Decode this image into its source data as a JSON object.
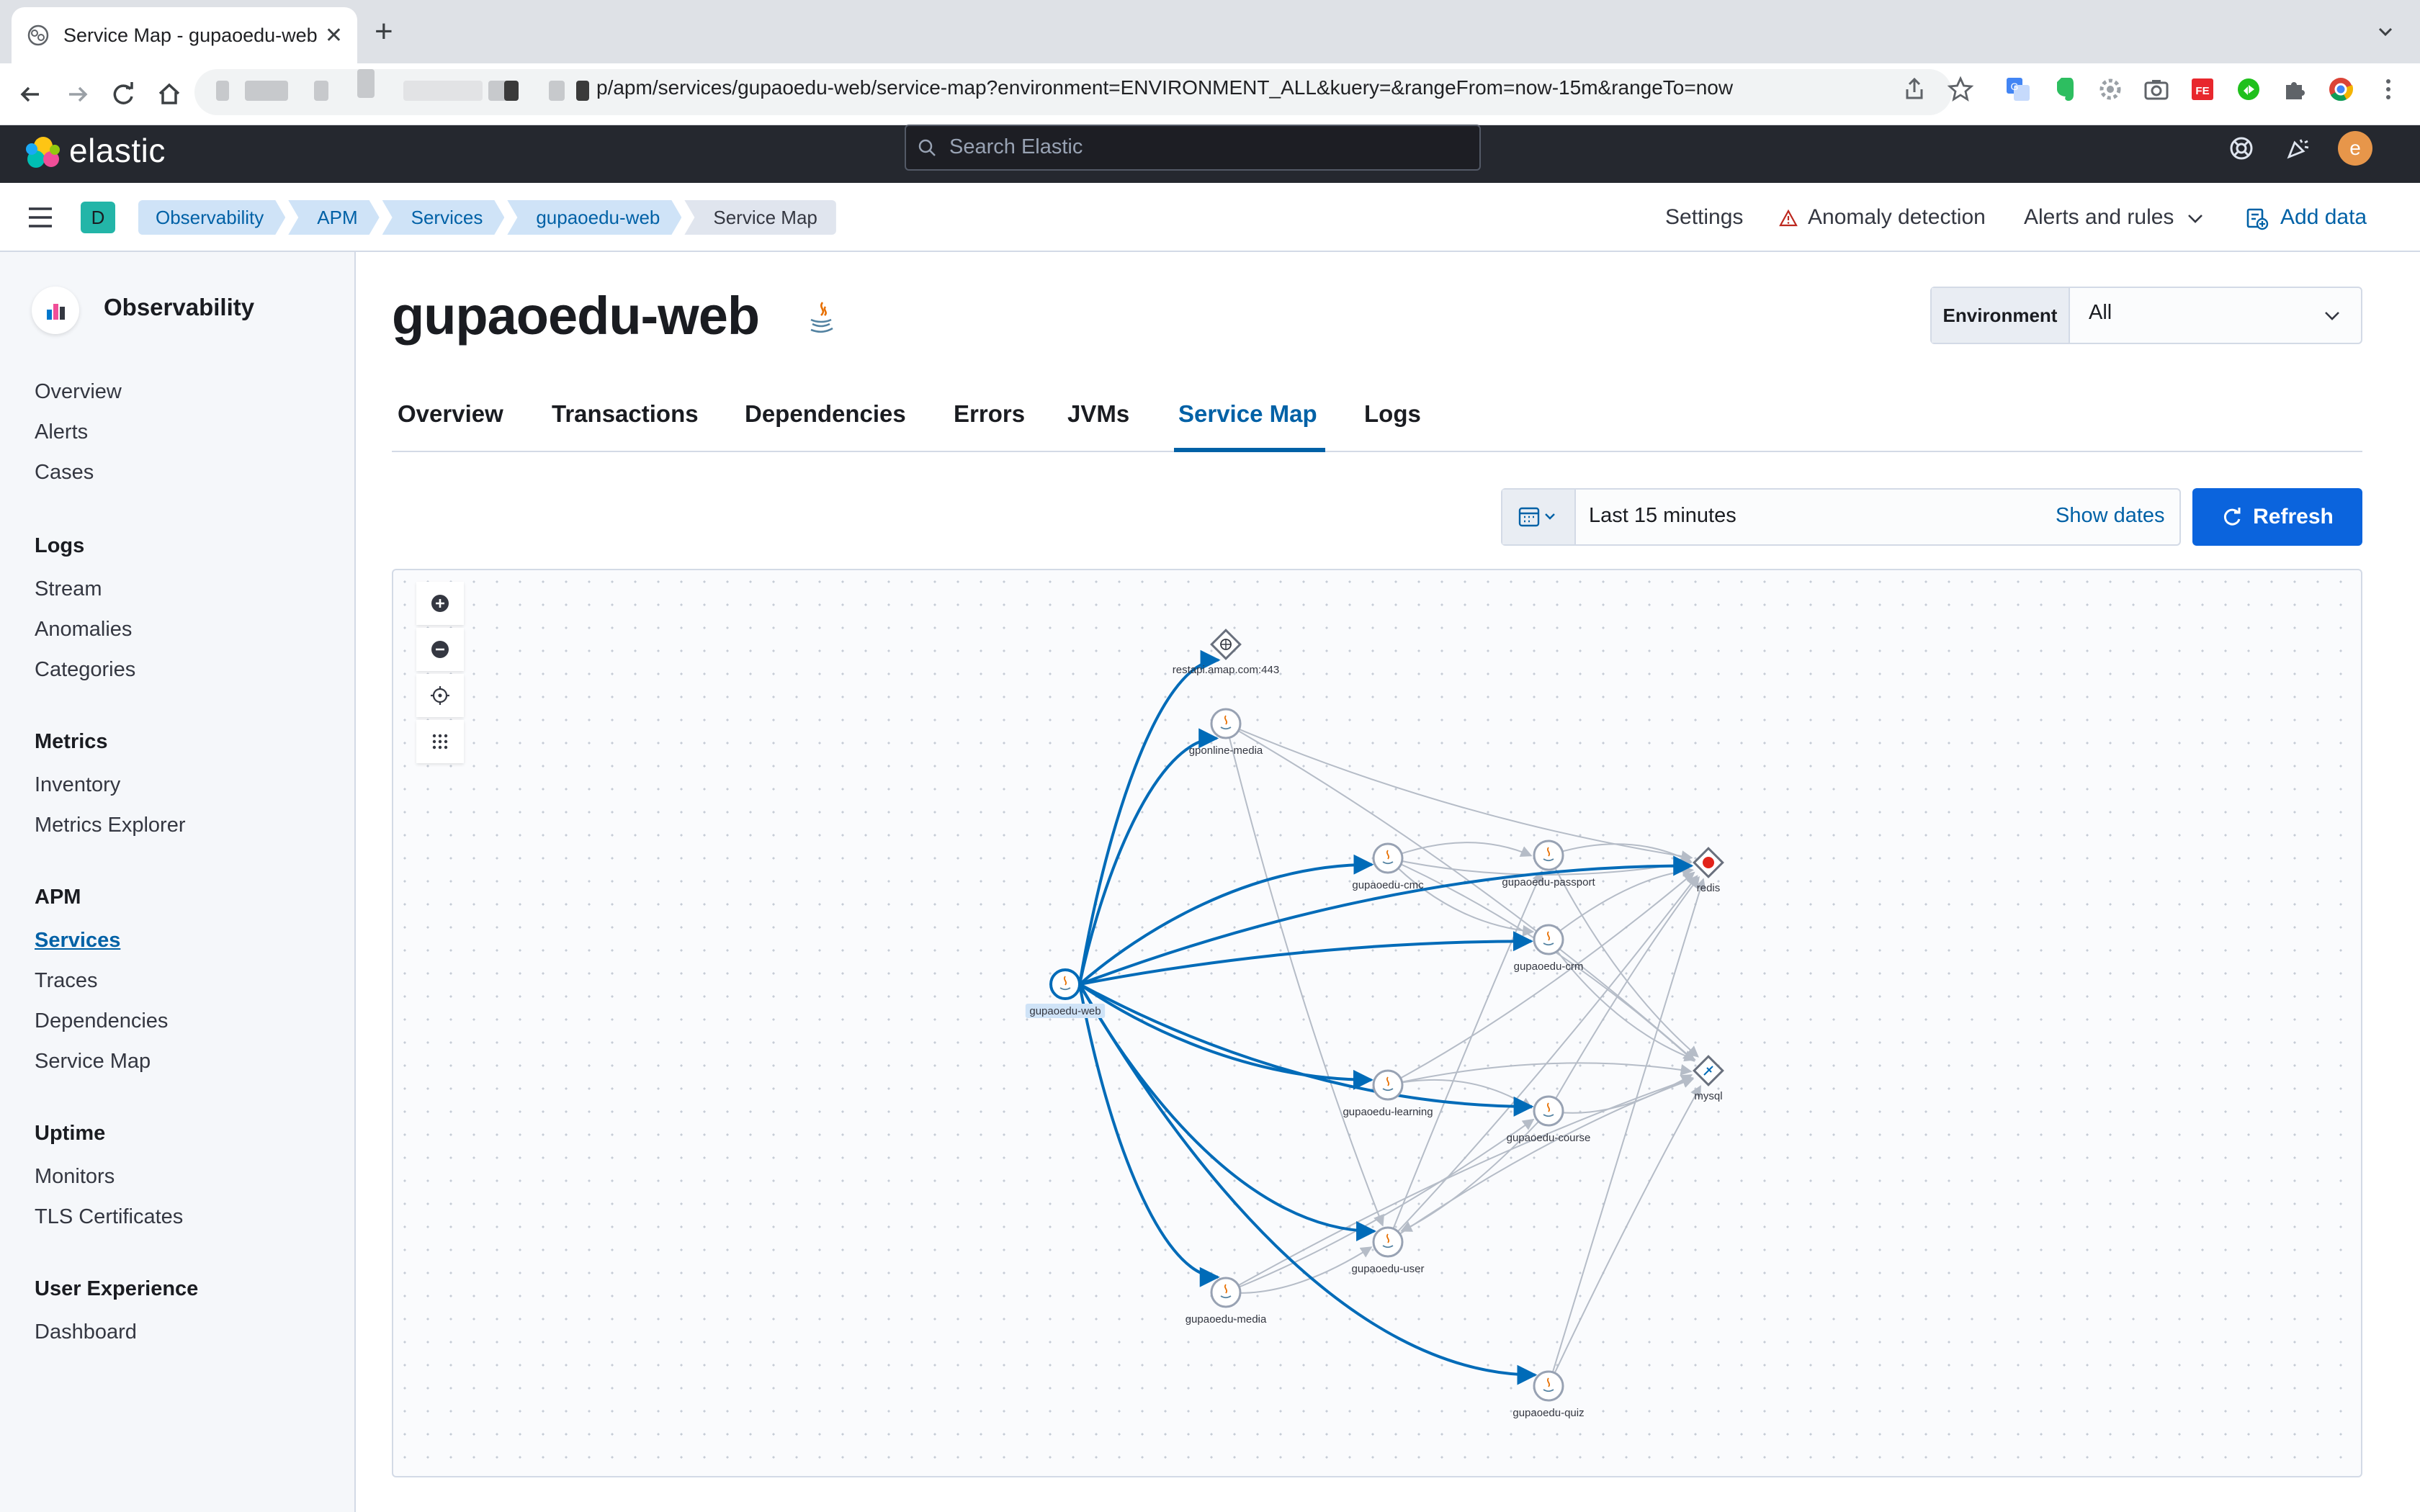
{
  "browser": {
    "tab_title": "Service Map - gupaoedu-web",
    "url_visible": "p/apm/services/gupaoedu-web/service-map?environment=ENVIRONMENT_ALL&kuery=&rangeFrom=now-15m&rangeTo=now"
  },
  "header": {
    "logo_text": "elastic",
    "search_placeholder": "Search Elastic",
    "avatar_initial": "e"
  },
  "breadcrumbs": {
    "space_initial": "D",
    "items": [
      "Observability",
      "APM",
      "Services",
      "gupaoedu-web",
      "Service Map"
    ],
    "settings": "Settings",
    "anomaly": "Anomaly detection",
    "alerts": "Alerts and rules",
    "add_data": "Add data"
  },
  "sidebar": {
    "title": "Observability",
    "top_items": [
      "Overview",
      "Alerts",
      "Cases"
    ],
    "groups": [
      {
        "label": "Logs",
        "items": [
          "Stream",
          "Anomalies",
          "Categories"
        ]
      },
      {
        "label": "Metrics",
        "items": [
          "Inventory",
          "Metrics Explorer"
        ]
      },
      {
        "label": "APM",
        "items": [
          "Services",
          "Traces",
          "Dependencies",
          "Service Map"
        ]
      },
      {
        "label": "Uptime",
        "items": [
          "Monitors",
          "TLS Certificates"
        ]
      },
      {
        "label": "User Experience",
        "items": [
          "Dashboard"
        ]
      }
    ],
    "active": "Services"
  },
  "main": {
    "title": "gupaoedu-web",
    "environment_label": "Environment",
    "environment_value": "All",
    "tabs": [
      "Overview",
      "Transactions",
      "Dependencies",
      "Errors",
      "JVMs",
      "Service Map",
      "Logs"
    ],
    "selected_tab": "Service Map",
    "date_range": "Last 15 minutes",
    "show_dates": "Show dates",
    "refresh": "Refresh"
  },
  "service_map": {
    "nodes": [
      {
        "id": "restapi",
        "label": "restapi.amap.com:443",
        "kind": "external"
      },
      {
        "id": "online-media",
        "label": "gponline-media",
        "kind": "service"
      },
      {
        "id": "cmc",
        "label": "gupaoedu-cmc",
        "kind": "service"
      },
      {
        "id": "passport",
        "label": "gupaoedu-passport",
        "kind": "service"
      },
      {
        "id": "redis",
        "label": "redis",
        "kind": "redis"
      },
      {
        "id": "crm",
        "label": "gupaoedu-crm",
        "kind": "service"
      },
      {
        "id": "web",
        "label": "gupaoedu-web",
        "kind": "service-selected"
      },
      {
        "id": "learning",
        "label": "gupaoedu-learning",
        "kind": "service"
      },
      {
        "id": "course",
        "label": "gupaoedu-course",
        "kind": "service"
      },
      {
        "id": "mysql",
        "label": "mysql",
        "kind": "database"
      },
      {
        "id": "user",
        "label": "gupaoedu-user",
        "kind": "service"
      },
      {
        "id": "media",
        "label": "gupaoedu-media",
        "kind": "service"
      },
      {
        "id": "quiz",
        "label": "gupaoedu-quiz",
        "kind": "service"
      }
    ],
    "primary_edges": [
      [
        "web",
        "restapi"
      ],
      [
        "web",
        "online-media"
      ],
      [
        "web",
        "cmc"
      ],
      [
        "web",
        "redis"
      ],
      [
        "web",
        "crm"
      ],
      [
        "web",
        "learning"
      ],
      [
        "web",
        "course"
      ],
      [
        "web",
        "user"
      ],
      [
        "web",
        "media"
      ],
      [
        "web",
        "quiz"
      ]
    ],
    "secondary_edges": [
      [
        "online-media",
        "redis"
      ],
      [
        "online-media",
        "mysql"
      ],
      [
        "online-media",
        "user"
      ],
      [
        "cmc",
        "passport"
      ],
      [
        "cmc",
        "redis"
      ],
      [
        "cmc",
        "mysql"
      ],
      [
        "cmc",
        "crm"
      ],
      [
        "passport",
        "redis"
      ],
      [
        "passport",
        "mysql"
      ],
      [
        "crm",
        "redis"
      ],
      [
        "crm",
        "mysql"
      ],
      [
        "learning",
        "mysql"
      ],
      [
        "learning",
        "redis"
      ],
      [
        "learning",
        "course"
      ],
      [
        "course",
        "mysql"
      ],
      [
        "course",
        "redis"
      ],
      [
        "course",
        "user"
      ],
      [
        "user",
        "mysql"
      ],
      [
        "user",
        "redis"
      ],
      [
        "user",
        "passport"
      ],
      [
        "media",
        "user"
      ],
      [
        "media",
        "mysql"
      ],
      [
        "media",
        "course"
      ],
      [
        "quiz",
        "mysql"
      ],
      [
        "quiz",
        "redis"
      ]
    ],
    "colors": {
      "primary": "#006bb8",
      "secondary": "#b5bcc7",
      "redis": "#e2231a",
      "accent": "#0b64dd"
    }
  }
}
